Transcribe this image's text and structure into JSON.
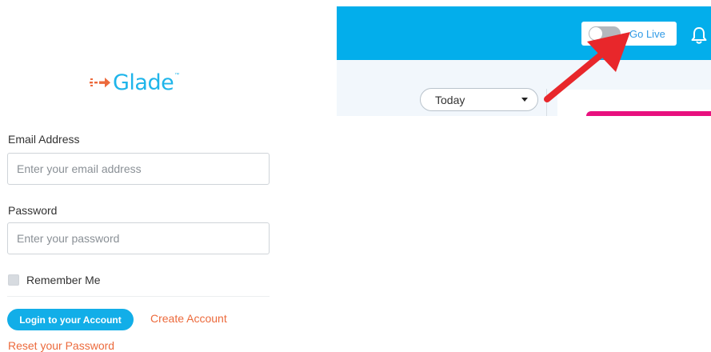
{
  "brand": {
    "name": "Glade",
    "trademark": "™",
    "color": "#1fb5ea",
    "accent": "#ec6a3c",
    "logo_icon": "dashed-arrow-logo-icon"
  },
  "login": {
    "email_label": "Email Address",
    "email_placeholder": "Enter your email address",
    "password_label": "Password",
    "password_placeholder": "Enter your password",
    "remember_label": "Remember Me",
    "remember_checked": false,
    "login_button": "Login to your Account",
    "create_account": "Create Account",
    "reset_password": "Reset your Password"
  },
  "dashboard": {
    "topbar_color": "#03aeeb",
    "go_live_label": "Go Live",
    "go_live_on": false,
    "notification_icon": "bell-icon",
    "date_filter": "Today",
    "highlight_arrow_color": "#e8272b"
  }
}
